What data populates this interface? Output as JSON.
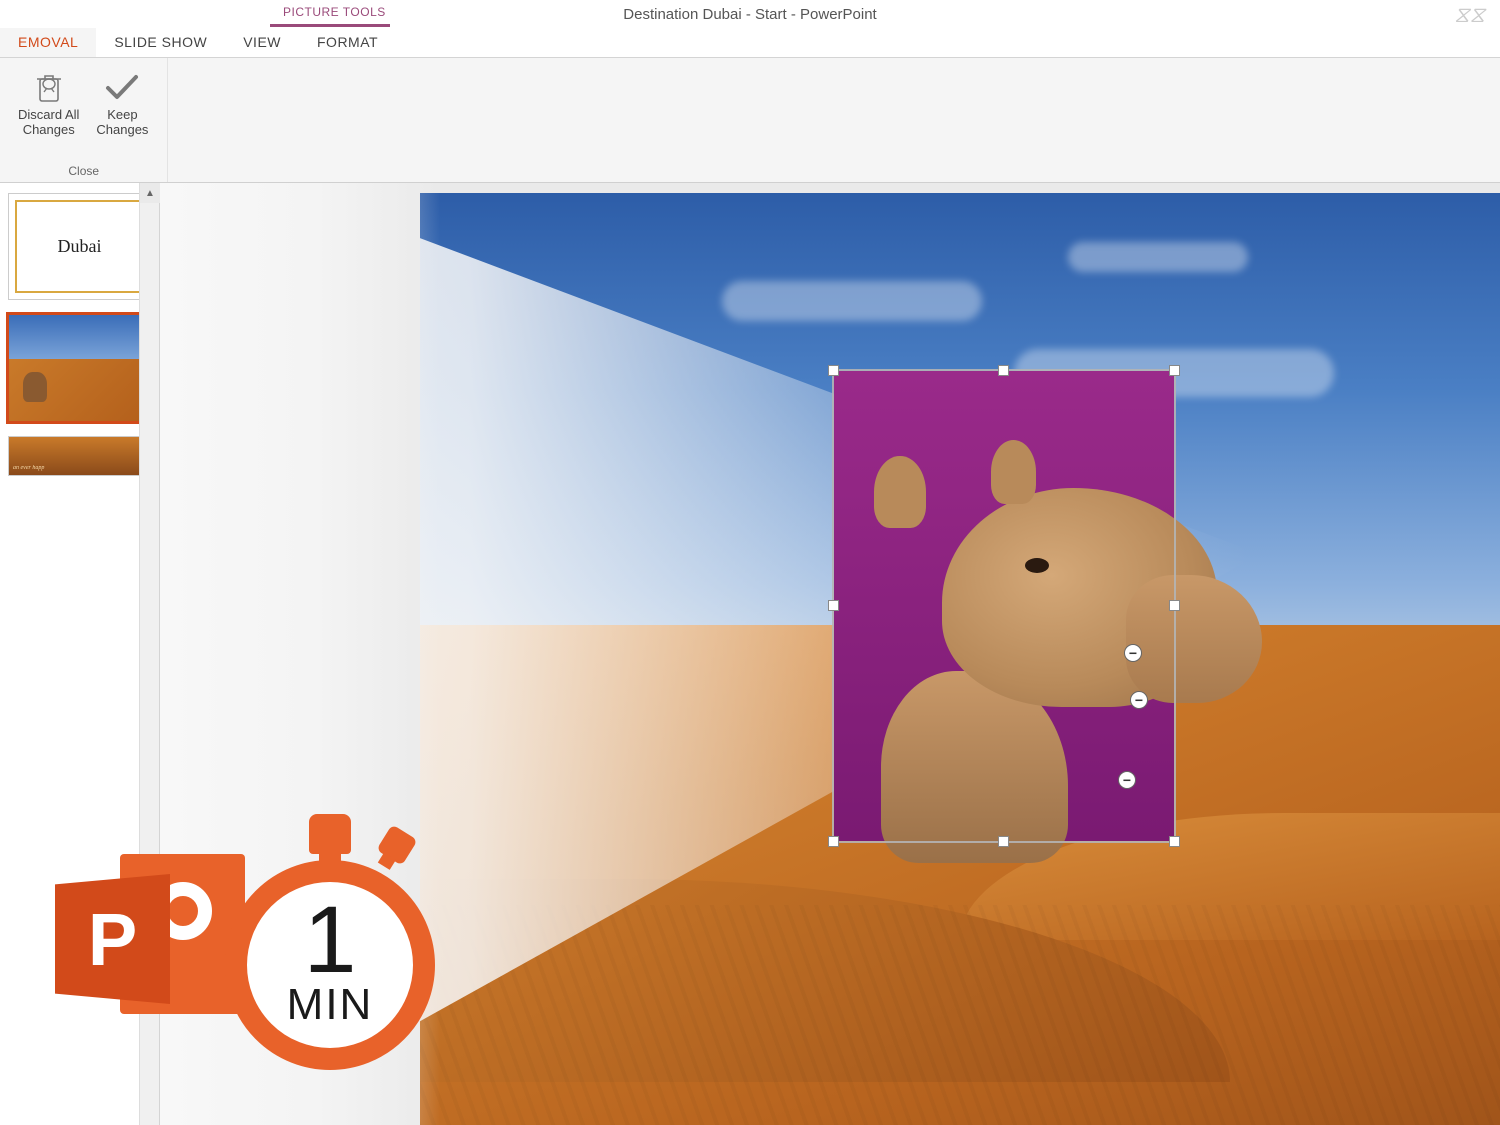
{
  "window": {
    "title": "Destination Dubai - Start - PowerPoint",
    "context_tab_label": "PICTURE TOOLS"
  },
  "tabs": {
    "active": "EMOVAL",
    "items": [
      "EMOVAL",
      "SLIDE SHOW",
      "VIEW",
      "FORMAT"
    ]
  },
  "ribbon": {
    "close_group": {
      "label": "Close",
      "discard": {
        "line1": "Discard All",
        "line2": "Changes"
      },
      "keep": {
        "line1": "Keep",
        "line2": "Changes"
      }
    }
  },
  "thumbnails": {
    "selected_index": 1,
    "slide1_text": "Dubai"
  },
  "overlay": {
    "logo_letter": "P",
    "stopwatch_number": "1",
    "stopwatch_unit": "MIN"
  },
  "selection": {
    "minus_markers": 3
  }
}
